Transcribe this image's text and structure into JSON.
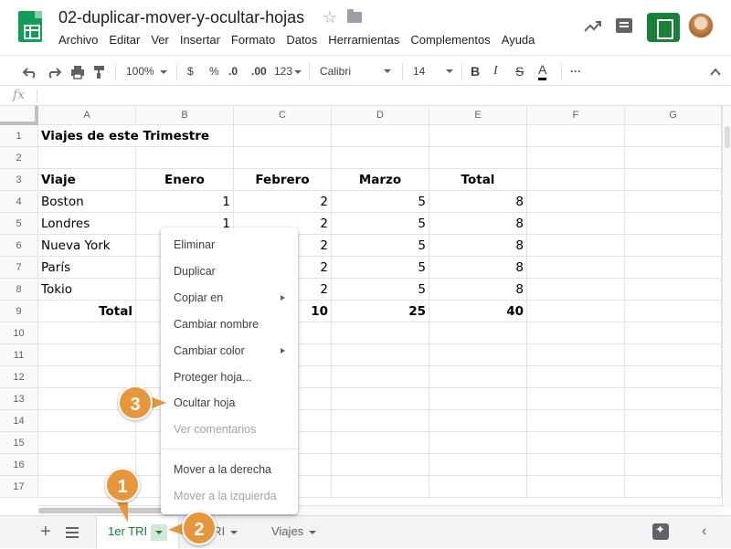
{
  "header": {
    "doc_title": "02-duplicar-mover-y-ocultar-hojas",
    "menu": [
      "Archivo",
      "Editar",
      "Ver",
      "Insertar",
      "Formato",
      "Datos",
      "Herramientas",
      "Complementos",
      "Ayuda"
    ]
  },
  "toolbar": {
    "zoom": "100%",
    "currency": "$",
    "percent": "%",
    "decimal_less": ".0",
    "decimal_more": ".00",
    "more_formats": "123",
    "font": "Calibri",
    "font_size": "14",
    "bold": "B",
    "italic": "I",
    "strike": "S",
    "text_color": "A",
    "more": "···"
  },
  "formula_bar": {
    "fx": "fx"
  },
  "grid": {
    "columns": [
      "A",
      "B",
      "C",
      "D",
      "E",
      "F",
      "G"
    ],
    "rows": [
      "1",
      "2",
      "3",
      "4",
      "5",
      "6",
      "7",
      "8",
      "9",
      "10",
      "11",
      "12",
      "13",
      "14",
      "15",
      "16",
      "17"
    ],
    "cells": {
      "title": "Viajes de este Trimestre",
      "header": [
        "Viaje",
        "Enero",
        "Febrero",
        "Marzo",
        "Total"
      ],
      "data": [
        [
          "Boston",
          "1",
          "2",
          "5",
          "8"
        ],
        [
          "Londres",
          "1",
          "2",
          "5",
          "8"
        ],
        [
          "Nueva York",
          "",
          "2",
          "5",
          "8"
        ],
        [
          "París",
          "",
          "2",
          "5",
          "8"
        ],
        [
          "Tokio",
          "",
          "2",
          "5",
          "8"
        ]
      ],
      "total_label": "Total",
      "totals": [
        "",
        "10",
        "25",
        "40"
      ]
    }
  },
  "context_menu": {
    "items": [
      {
        "label": "Eliminar",
        "disabled": false
      },
      {
        "label": "Duplicar",
        "disabled": false
      },
      {
        "label": "Copiar en",
        "disabled": false,
        "submenu": true
      },
      {
        "label": "Cambiar nombre",
        "disabled": false
      },
      {
        "label": "Cambiar color",
        "disabled": false,
        "submenu": true
      },
      {
        "label": "Proteger hoja...",
        "disabled": false
      },
      {
        "label": "Ocultar hoja",
        "disabled": false
      },
      {
        "label": "Ver comentarios",
        "disabled": true
      },
      {
        "label": "Mover a la derecha",
        "disabled": false
      },
      {
        "label": "Mover a la izquierda",
        "disabled": true
      }
    ]
  },
  "sheets": {
    "tabs": [
      "1er TRI",
      "2º TRI",
      "Viajes"
    ],
    "active_index": 0
  },
  "callouts": [
    "1",
    "2",
    "3"
  ],
  "colors": {
    "sheets_green": "#0f9d58",
    "share_green": "#188038",
    "callout_orange": "#e8963b"
  }
}
